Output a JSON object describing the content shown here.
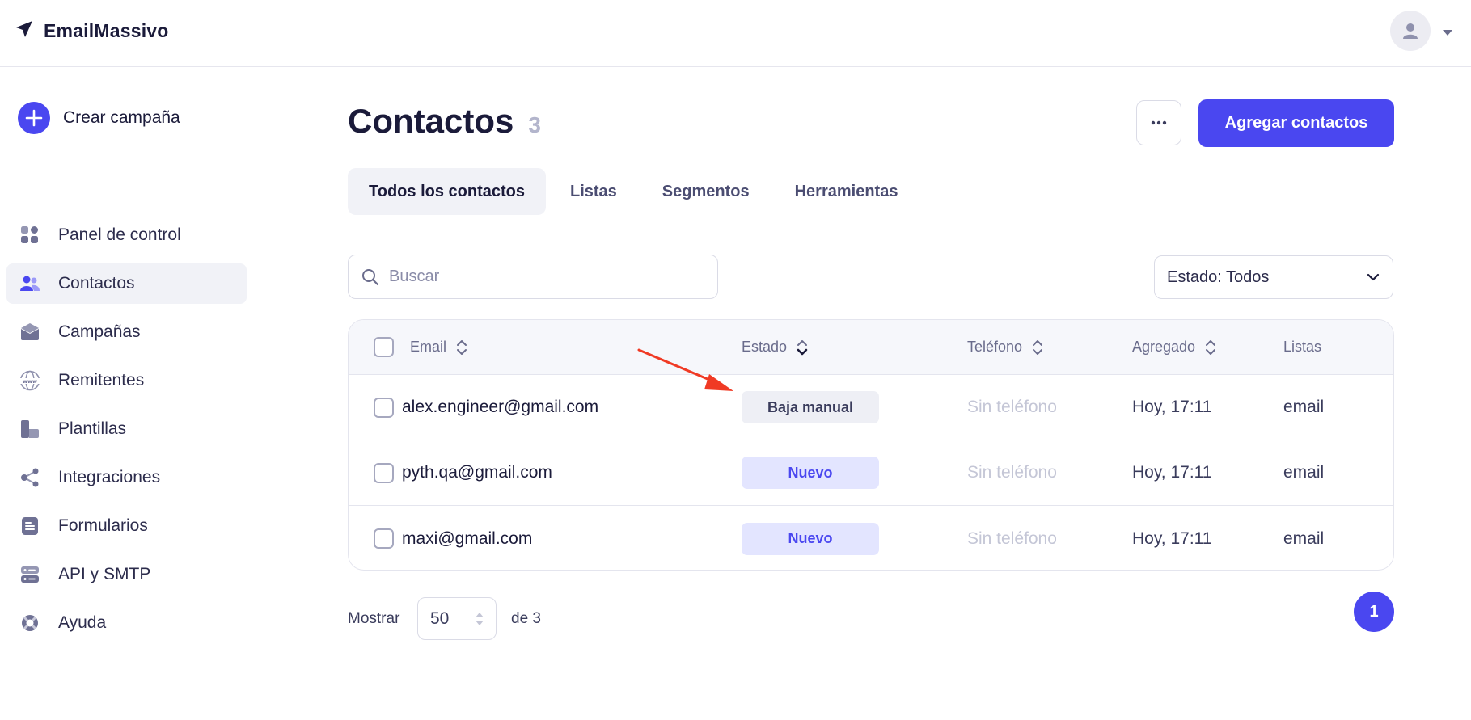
{
  "brand": {
    "name": "EmailMassivo"
  },
  "sidebar": {
    "create_label": "Crear campaña",
    "items": [
      {
        "label": "Panel de control",
        "icon": "dashboard-icon",
        "active": false
      },
      {
        "label": "Contactos",
        "icon": "users-icon",
        "active": true
      },
      {
        "label": "Campañas",
        "icon": "envelope-icon",
        "active": false
      },
      {
        "label": "Remitentes",
        "icon": "globe-www-icon",
        "active": false
      },
      {
        "label": "Plantillas",
        "icon": "templates-icon",
        "active": false
      },
      {
        "label": "Integraciones",
        "icon": "share-nodes-icon",
        "active": false
      },
      {
        "label": "Formularios",
        "icon": "form-icon",
        "active": false
      },
      {
        "label": "API y SMTP",
        "icon": "server-icon",
        "active": false
      },
      {
        "label": "Ayuda",
        "icon": "lifebuoy-icon",
        "active": false
      }
    ]
  },
  "header": {
    "title": "Contactos",
    "count": "3",
    "more_label": "···",
    "add_label": "Agregar contactos"
  },
  "tabs": [
    {
      "label": "Todos los contactos",
      "active": true
    },
    {
      "label": "Listas",
      "active": false
    },
    {
      "label": "Segmentos",
      "active": false
    },
    {
      "label": "Herramientas",
      "active": false
    }
  ],
  "search": {
    "placeholder": "Buscar",
    "value": ""
  },
  "filter": {
    "label": "Estado: Todos"
  },
  "table": {
    "columns": [
      "Email",
      "Estado",
      "Teléfono",
      "Agregado",
      "Listas"
    ],
    "rows": [
      {
        "email": "alex.engineer@gmail.com",
        "status": "Baja manual",
        "status_style": "gray",
        "phone": "Sin teléfono",
        "added": "Hoy, 17:11",
        "lists": "email"
      },
      {
        "email": "pyth.qa@gmail.com",
        "status": "Nuevo",
        "status_style": "blue",
        "phone": "Sin teléfono",
        "added": "Hoy, 17:11",
        "lists": "email"
      },
      {
        "email": "maxi@gmail.com",
        "status": "Nuevo",
        "status_style": "blue",
        "phone": "Sin teléfono",
        "added": "Hoy, 17:11",
        "lists": "email"
      }
    ]
  },
  "footer": {
    "show_label": "Mostrar",
    "per_page": "50",
    "of_label": "de 3",
    "current_page": "1"
  },
  "colors": {
    "accent": "#4a47f0",
    "annotation_arrow": "#f03a24",
    "text_dark": "#1b1b3a"
  }
}
